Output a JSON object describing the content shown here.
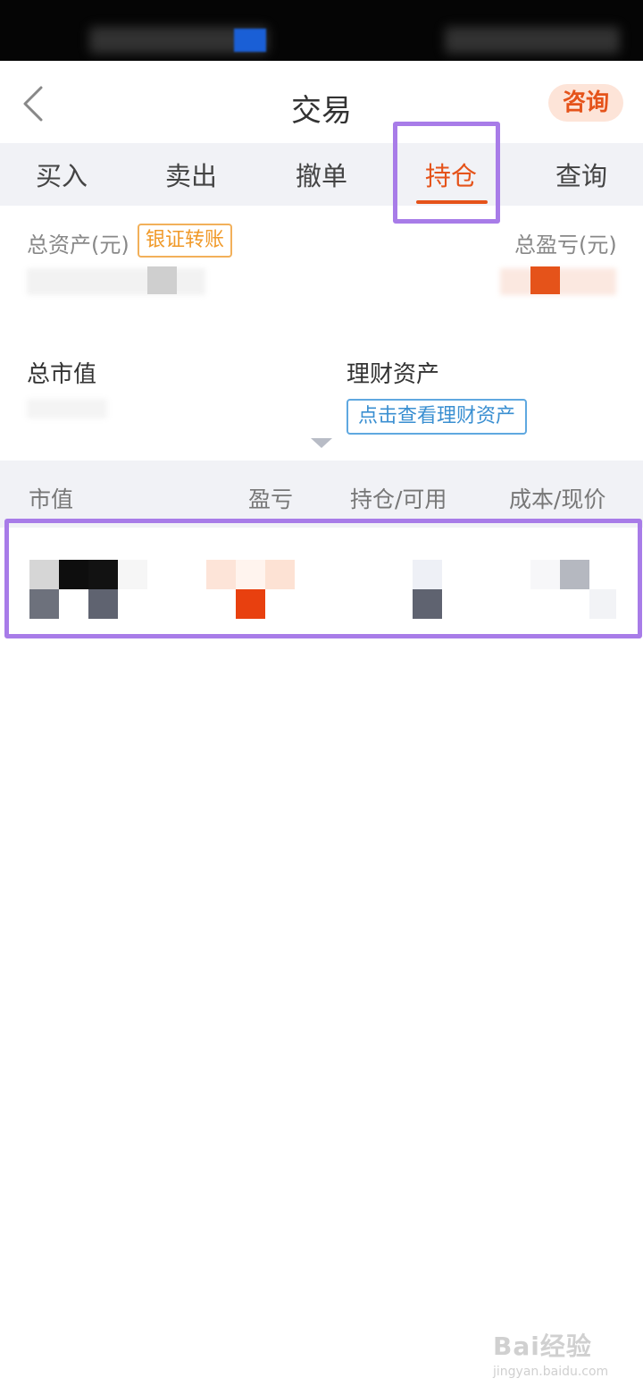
{
  "header": {
    "title": "交易",
    "consult_label": "咨询"
  },
  "tabs": [
    {
      "label": "买入"
    },
    {
      "label": "卖出"
    },
    {
      "label": "撤单"
    },
    {
      "label": "持仓"
    },
    {
      "label": "查询"
    }
  ],
  "active_tab": "持仓",
  "assets": {
    "total_assets_label": "总资产(元)",
    "transfer_label": "银证转账",
    "total_pnl_label": "总盈亏(元)",
    "market_value_label": "总市值",
    "wealth_label": "理财资产",
    "view_wealth_label": "点击查看理财资产"
  },
  "table": {
    "headers": [
      "市值",
      "盈亏",
      "持仓/可用",
      "成本/现价"
    ]
  },
  "watermark": {
    "main": "Bai经验",
    "sub": "jingyan.baidu.com"
  },
  "colors": {
    "accent": "#e5531a",
    "highlight": "#a87ce8",
    "link": "#3a8fd1",
    "transfer": "#f09a2a"
  }
}
